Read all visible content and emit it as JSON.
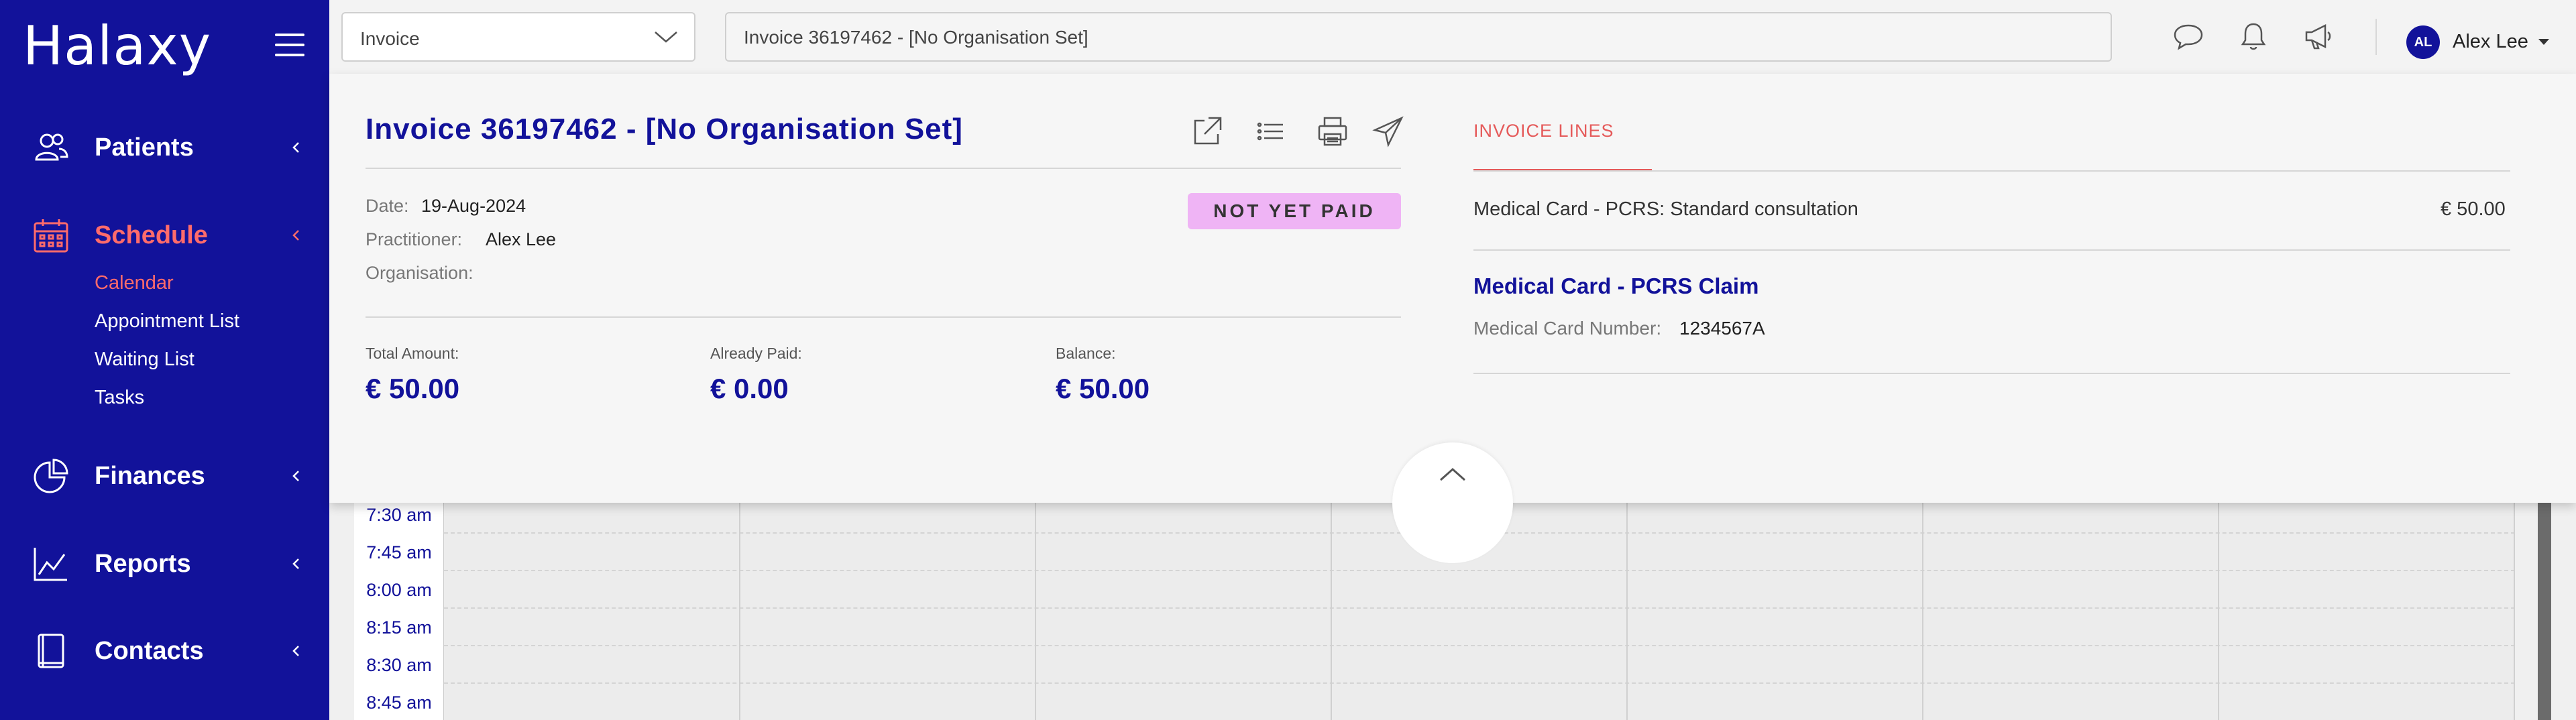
{
  "app": {
    "brand": "Halaxy"
  },
  "sidebar": {
    "items": [
      {
        "label": "Patients",
        "icon": "patients-icon"
      },
      {
        "label": "Schedule",
        "icon": "calendar-icon",
        "active": true
      },
      {
        "label": "Finances",
        "icon": "pie-chart-icon"
      },
      {
        "label": "Reports",
        "icon": "line-chart-icon"
      },
      {
        "label": "Contacts",
        "icon": "address-book-icon"
      }
    ],
    "schedule_sub": [
      {
        "label": "Calendar",
        "active": true
      },
      {
        "label": "Appointment List"
      },
      {
        "label": "Waiting List"
      },
      {
        "label": "Tasks"
      }
    ]
  },
  "topbar": {
    "search_type": "Invoice",
    "search_value": "Invoice 36197462 - [No Organisation Set]",
    "user_initials": "AL",
    "user_name": "Alex Lee"
  },
  "invoice": {
    "title": "Invoice 36197462 - [No Organisation Set]",
    "date_label": "Date:",
    "date_value": "19-Aug-2024",
    "practitioner_label": "Practitioner:",
    "practitioner_value": "Alex Lee",
    "organisation_label": "Organisation:",
    "organisation_value": "",
    "status": "NOT YET PAID",
    "total_label": "Total Amount:",
    "total_value": "€ 50.00",
    "paid_label": "Already Paid:",
    "paid_value": "€ 0.00",
    "balance_label": "Balance:",
    "balance_value": "€ 50.00"
  },
  "invoice_lines": {
    "tab_label": "INVOICE LINES",
    "lines": [
      {
        "description": "Medical Card - PCRS: Standard consultation",
        "amount": "€ 50.00"
      }
    ],
    "claim_title": "Medical Card - PCRS Claim",
    "card_number_label": "Medical Card Number:",
    "card_number_value": "1234567A"
  },
  "calendar": {
    "times": [
      "7:30 am",
      "7:45 am",
      "8:00 am",
      "8:15 am",
      "8:30 am",
      "8:45 am"
    ]
  },
  "colors": {
    "brand": "#12129a",
    "accent": "#ff6b6b",
    "status_badge": "#efb4f5"
  }
}
